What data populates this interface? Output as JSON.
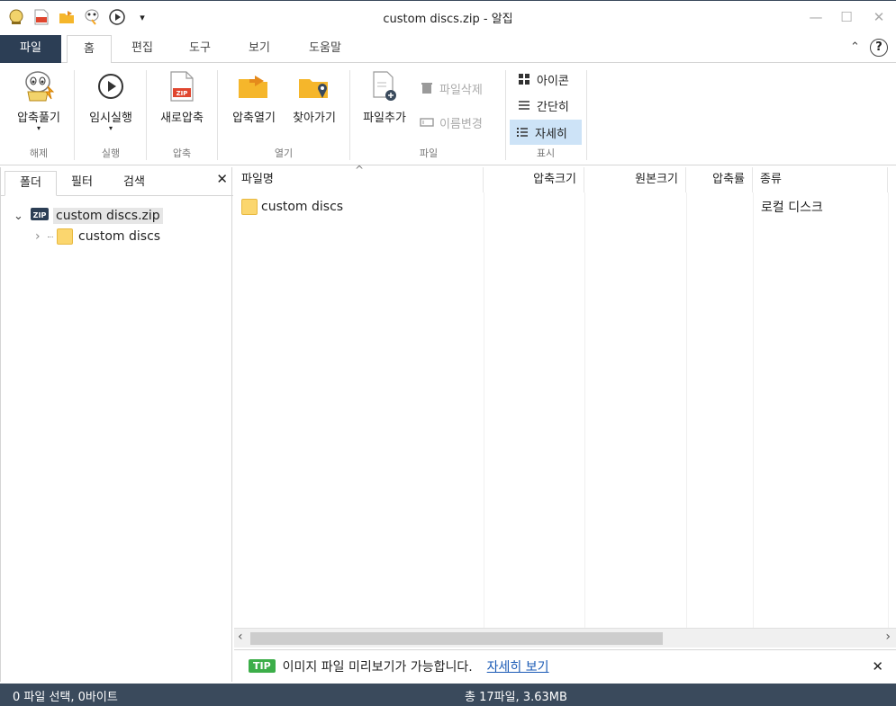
{
  "window": {
    "title": "custom discs.zip - 알집",
    "minimize": "—",
    "maximize": "☐",
    "close": "✕"
  },
  "tabs": {
    "file": "파일",
    "home": "홈",
    "edit": "편집",
    "tools": "도구",
    "view": "보기",
    "help": "도움말",
    "chevron": "⌃",
    "help_icon": "?"
  },
  "ribbon": {
    "extract_label": "압축풀기",
    "extract_group": "해제",
    "run_label": "임시실행",
    "run_group": "실행",
    "newzip_label": "새로압축",
    "compress_group": "압축",
    "open_label": "압축열기",
    "browse_label": "찾아가기",
    "open_group": "열기",
    "addfile_label": "파일추가",
    "deletefile_label": "파일삭제",
    "rename_label": "이름변경",
    "file_group": "파일",
    "icon_view_label": "아이콘",
    "simple_view_label": "간단히",
    "detail_view_label": "자세히",
    "display_group": "표시",
    "dropdown_arrow": "▾"
  },
  "left_pane": {
    "tab_folder": "폴더",
    "tab_filter": "필터",
    "tab_search": "검색",
    "close": "✕",
    "tree": [
      {
        "label": "custom discs.zip",
        "expander": "⌄"
      },
      {
        "label": "custom discs",
        "expander": "›"
      }
    ]
  },
  "file_list": {
    "columns": {
      "name": "파일명",
      "compressed": "압축크기",
      "original": "원본크기",
      "ratio": "압축률",
      "type": "종류"
    },
    "sort_indicator": "^",
    "rows": [
      {
        "name": "custom discs",
        "compressed": "",
        "original": "",
        "ratio": "",
        "type": "로컬 디스크"
      }
    ]
  },
  "scroll": {
    "left": "‹",
    "right": "›"
  },
  "tip": {
    "badge": "TIP",
    "text": "이미지 파일 미리보기가 가능합니다.",
    "link": "자세히 보기",
    "close": "✕"
  },
  "status": {
    "selection": "0 파일 선택,  0바이트",
    "total": "총 17파일,  3.63MB"
  },
  "colors": {
    "accent": "#2c3e55",
    "status_bg": "#3a4a5c",
    "folder": "#fbd66e",
    "tip_badge": "#3cae49",
    "link": "#1a5ab5",
    "selected_view": "#cde3f7"
  }
}
